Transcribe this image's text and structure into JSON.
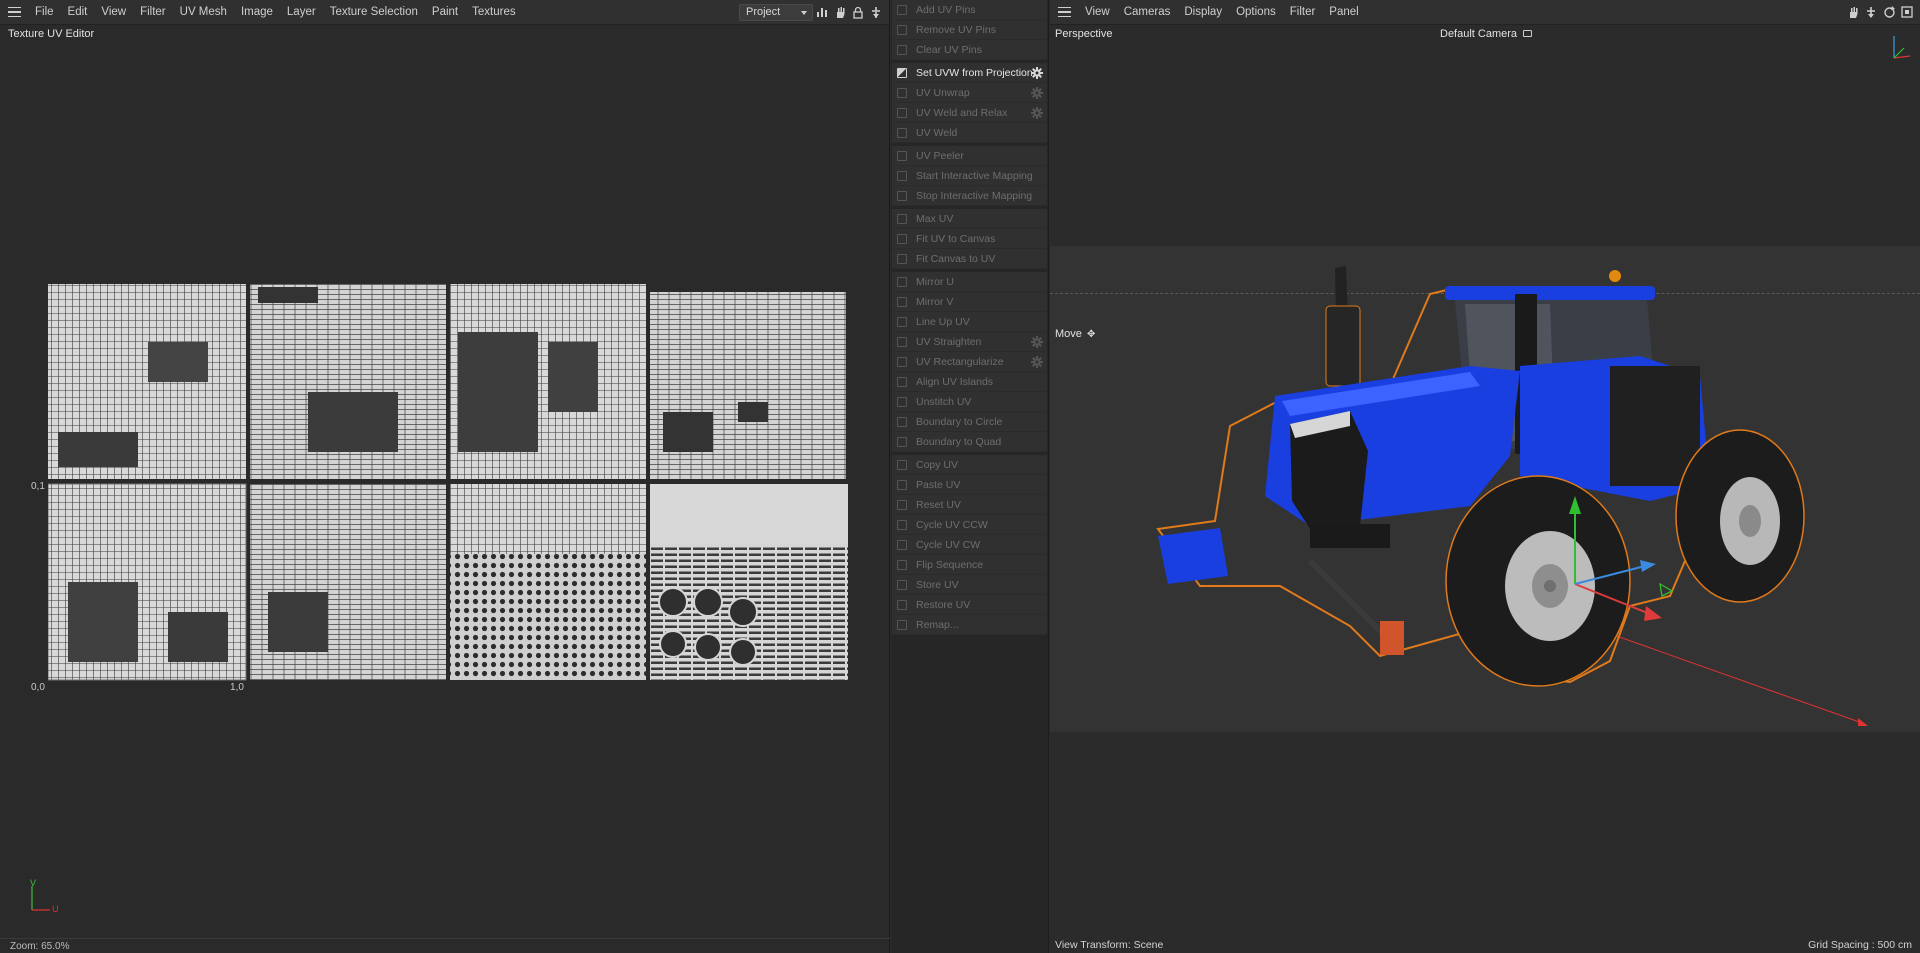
{
  "uv_editor": {
    "menu": [
      "File",
      "Edit",
      "View",
      "Filter",
      "UV Mesh",
      "Image",
      "Layer",
      "Texture Selection",
      "Paint",
      "Textures"
    ],
    "project_select": "Project",
    "panel_title": "Texture UV Editor",
    "axis": {
      "origin": "0,0",
      "u_one": "1,0",
      "v_one": "0,1",
      "corner_u": "U",
      "corner_v": "V"
    },
    "zoom": "Zoom: 65.0%"
  },
  "commands": {
    "groups": [
      {
        "items": [
          {
            "label": "Add UV Pins",
            "enabled": false,
            "gear": false
          },
          {
            "label": "Remove UV Pins",
            "enabled": false,
            "gear": false
          },
          {
            "label": "Clear UV Pins",
            "enabled": false,
            "gear": false
          }
        ]
      },
      {
        "items": [
          {
            "label": "Set UVW from Projection",
            "enabled": true,
            "gear": true
          },
          {
            "label": "UV Unwrap",
            "enabled": false,
            "gear": true
          },
          {
            "label": "UV Weld and Relax",
            "enabled": false,
            "gear": true
          },
          {
            "label": "UV Weld",
            "enabled": false,
            "gear": false
          }
        ]
      },
      {
        "items": [
          {
            "label": "UV Peeler",
            "enabled": false,
            "gear": false
          },
          {
            "label": "Start Interactive Mapping",
            "enabled": false,
            "gear": false
          },
          {
            "label": "Stop Interactive Mapping",
            "enabled": false,
            "gear": false
          }
        ]
      },
      {
        "items": [
          {
            "label": "Max UV",
            "enabled": false,
            "gear": false
          },
          {
            "label": "Fit UV to Canvas",
            "enabled": false,
            "gear": false
          },
          {
            "label": "Fit Canvas to UV",
            "enabled": false,
            "gear": false
          }
        ]
      },
      {
        "items": [
          {
            "label": "Mirror U",
            "enabled": false,
            "gear": false
          },
          {
            "label": "Mirror V",
            "enabled": false,
            "gear": false
          },
          {
            "label": "Line Up UV",
            "enabled": false,
            "gear": false
          },
          {
            "label": "UV Straighten",
            "enabled": false,
            "gear": true
          },
          {
            "label": "UV Rectangularize",
            "enabled": false,
            "gear": true
          },
          {
            "label": "Align UV Islands",
            "enabled": false,
            "gear": false
          },
          {
            "label": "Unstitch UV",
            "enabled": false,
            "gear": false
          },
          {
            "label": "Boundary to Circle",
            "enabled": false,
            "gear": false
          },
          {
            "label": "Boundary to Quad",
            "enabled": false,
            "gear": false
          }
        ]
      },
      {
        "items": [
          {
            "label": "Copy UV",
            "enabled": false,
            "gear": false
          },
          {
            "label": "Paste UV",
            "enabled": false,
            "gear": false
          },
          {
            "label": "Reset UV",
            "enabled": false,
            "gear": false
          },
          {
            "label": "Cycle UV CCW",
            "enabled": false,
            "gear": false
          },
          {
            "label": "Cycle UV CW",
            "enabled": false,
            "gear": false
          },
          {
            "label": "Flip Sequence",
            "enabled": false,
            "gear": false
          },
          {
            "label": "Store UV",
            "enabled": false,
            "gear": false
          },
          {
            "label": "Restore UV",
            "enabled": false,
            "gear": false
          },
          {
            "label": "Remap...",
            "enabled": false,
            "gear": false
          }
        ]
      }
    ]
  },
  "viewport": {
    "menu": [
      "View",
      "Cameras",
      "Display",
      "Options",
      "Filter",
      "Panel"
    ],
    "view_name": "Perspective",
    "camera": "Default Camera",
    "tool": "Move",
    "view_transform": "View Transform: Scene",
    "grid_spacing": "Grid Spacing : 500 cm",
    "colors": {
      "tractor_body": "#1a3fe0",
      "selection_outline": "#e07a1a",
      "tire": "#1c1c1c",
      "rim": "#b8b8b8"
    }
  }
}
